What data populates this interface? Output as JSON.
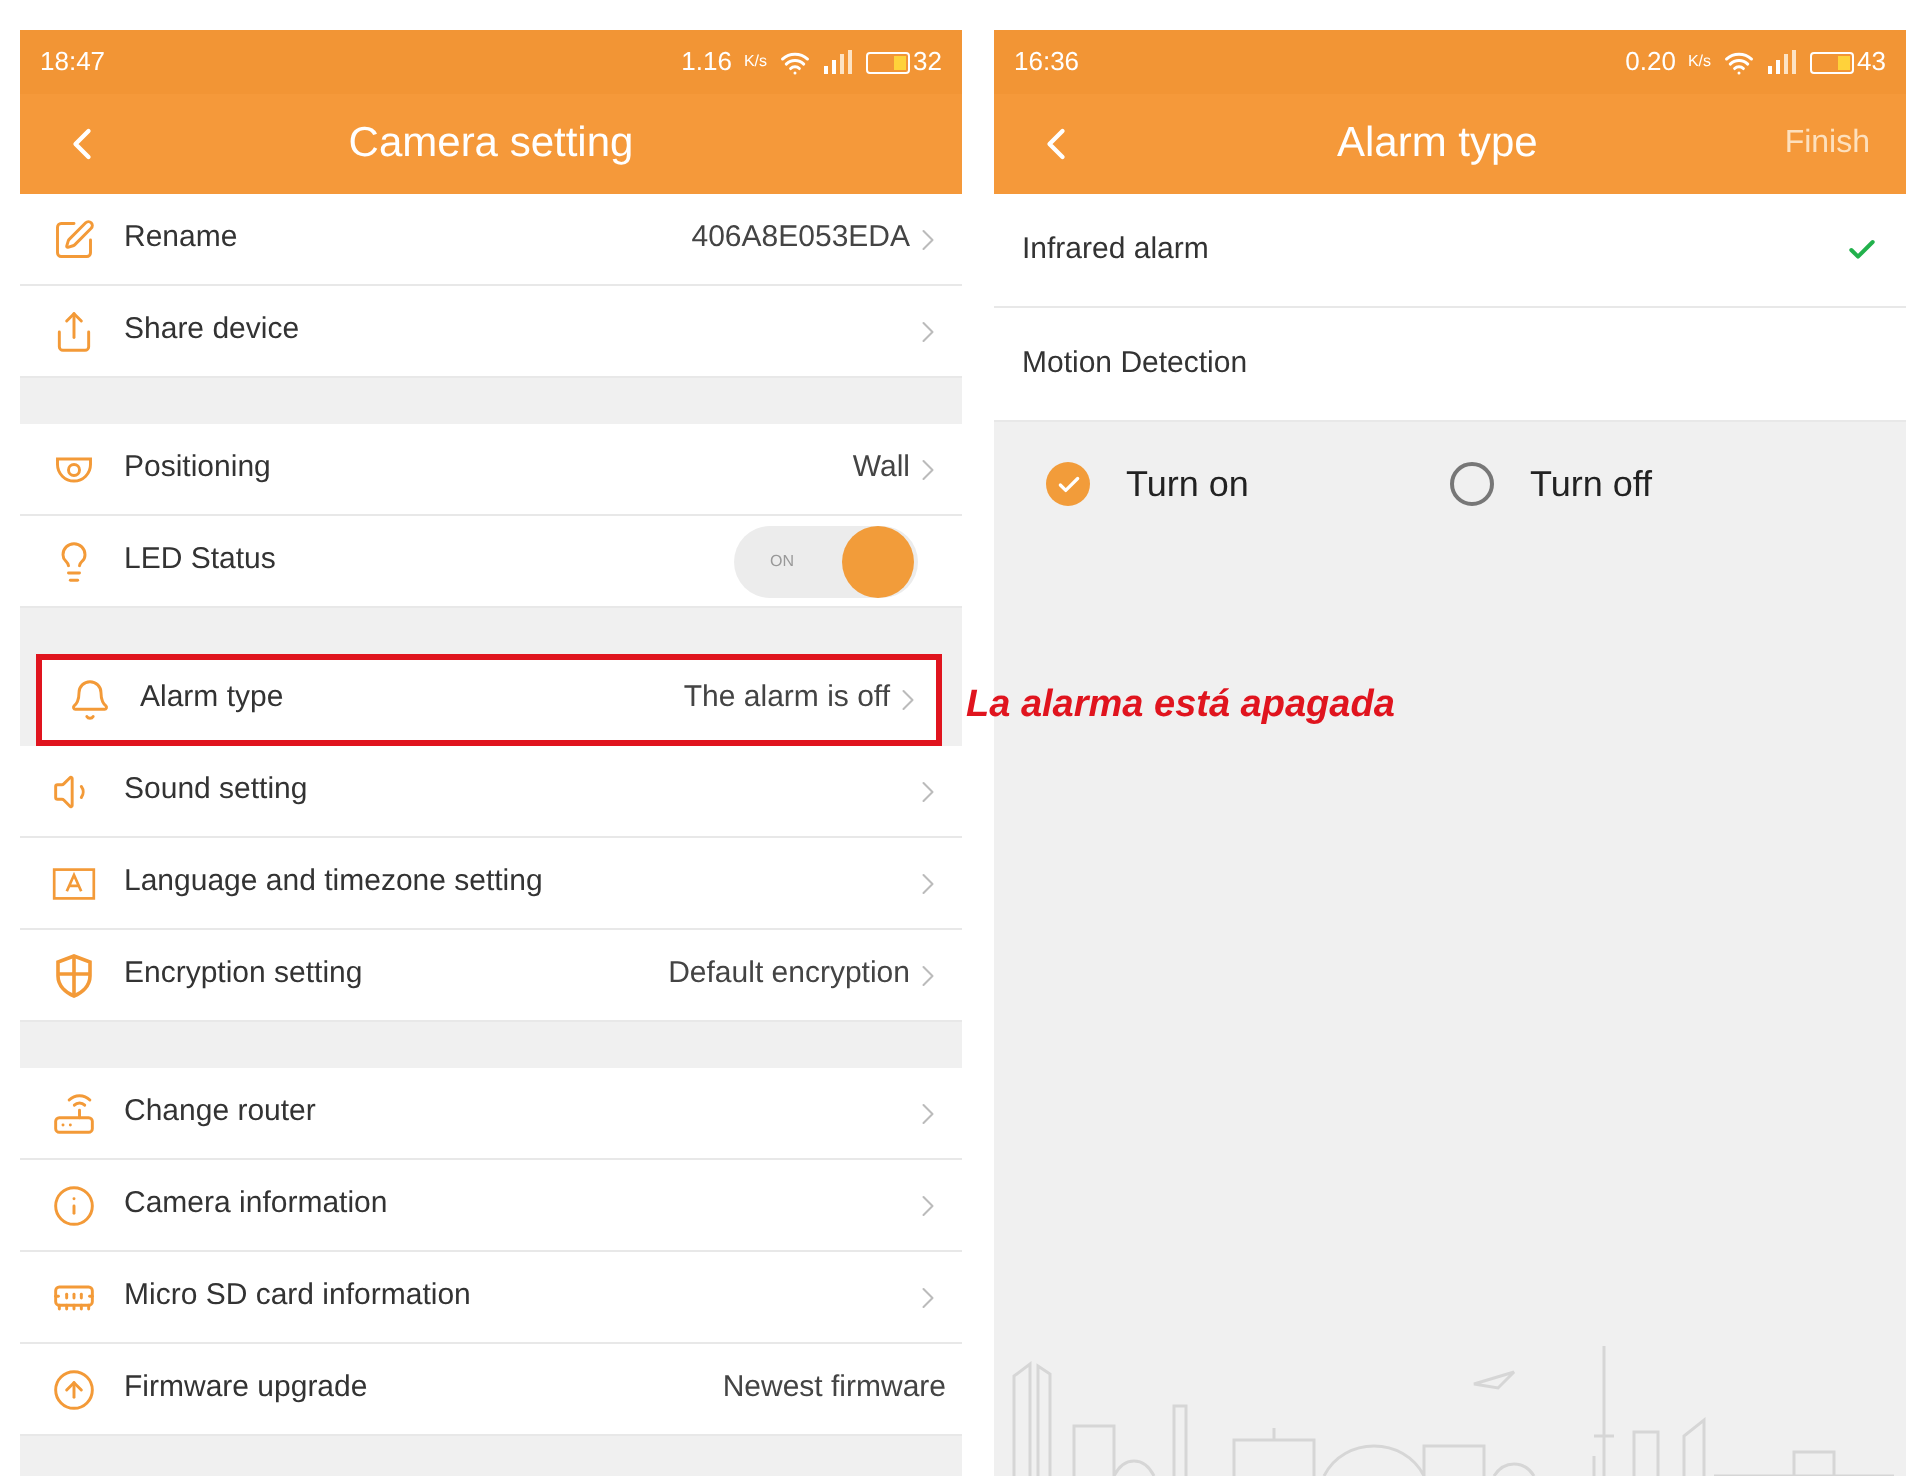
{
  "left_screen": {
    "status_bar": {
      "time": "18:47",
      "speed": "1.16",
      "speed_unit": "K/s",
      "battery": "32"
    },
    "title": "Camera setting",
    "groups": [
      {
        "rows": [
          {
            "label": "Rename",
            "value": "406A8E053EDA",
            "kind": "link",
            "highlighted": false
          },
          {
            "label": "Share device",
            "kind": "link",
            "highlighted": false
          }
        ]
      },
      {
        "rows": [
          {
            "label": "Positioning",
            "value": "Wall",
            "kind": "link",
            "highlighted": false
          },
          {
            "label": "LED Status",
            "kind": "toggle",
            "on": true,
            "toggle_label": "ON",
            "highlighted": false
          }
        ]
      },
      {
        "rows": [
          {
            "label": "Alarm type",
            "value": "The alarm is off",
            "kind": "link",
            "highlighted": true
          },
          {
            "label": "Sound setting",
            "kind": "link",
            "highlighted": false
          },
          {
            "label": "Language and timezone setting",
            "kind": "link",
            "highlighted": false
          },
          {
            "label": "Encryption setting",
            "value": "Default encryption",
            "kind": "link",
            "highlighted": false
          }
        ]
      },
      {
        "rows": [
          {
            "label": "Change router",
            "kind": "link",
            "highlighted": false
          },
          {
            "label": "Camera information",
            "kind": "link",
            "highlighted": false
          },
          {
            "label": "Micro SD card information",
            "kind": "link",
            "highlighted": false
          },
          {
            "label": "Firmware upgrade",
            "value": "Newest firmware",
            "kind": "plain",
            "highlighted": false
          }
        ]
      }
    ]
  },
  "annotation": "La alarma está apagada",
  "right_screen": {
    "status_bar": {
      "time": "16:36",
      "speed": "0.20",
      "speed_unit": "K/s",
      "battery": "43"
    },
    "title": "Alarm type",
    "action": "Finish",
    "alarm_types": [
      {
        "label": "Infrared alarm",
        "selected": true
      },
      {
        "label": "Motion Detection",
        "selected": false
      }
    ],
    "switch_options": [
      {
        "label": "Turn on",
        "selected": true
      },
      {
        "label": "Turn off",
        "selected": false
      }
    ]
  }
}
